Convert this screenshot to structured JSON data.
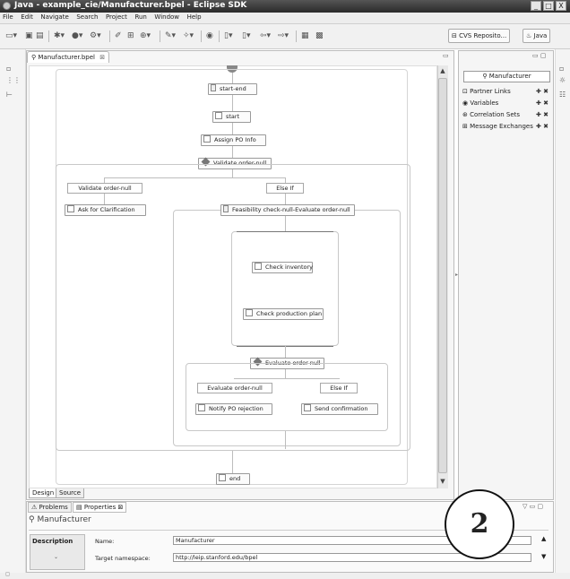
{
  "window": {
    "title": "Java - example_cie/Manufacturer.bpel - Eclipse SDK",
    "controls": [
      "_",
      "□",
      "X"
    ]
  },
  "menu": [
    "File",
    "Edit",
    "Navigate",
    "Search",
    "Project",
    "Run",
    "Window",
    "Help"
  ],
  "toolbar": {
    "cvs_label": "CVS Reposito...",
    "perspective_label": "Java"
  },
  "editor": {
    "tab_label": "Manufacturer.bpel",
    "tab_close": "⊠",
    "bottom_tabs": [
      "Design",
      "Source"
    ]
  },
  "palette": {
    "title": "Manufacturer",
    "sections": [
      "Partner Links",
      "Variables",
      "Correlation Sets",
      "Message Exchanges"
    ],
    "actions": "✚ ✖"
  },
  "diagram": {
    "start_end": "start-end",
    "start": "start",
    "assign": "Assign PO Info",
    "validate_switch": "Validate order-null",
    "case_label": "Validate order-null",
    "else_label": "Else If",
    "ask": "Ask for Clarification",
    "feasibility": "Feasibility check-null-Evaluate order-null",
    "check_inventory": "Check inventory",
    "check_production": "Check production plan",
    "evaluate_switch": "Evaluate order-null",
    "eval_case_label": "Evaluate order-null",
    "eval_else_label": "Else If",
    "notify": "Notify PO rejection",
    "send": "Send confirmation",
    "end": "end"
  },
  "bottom": {
    "tabs": [
      "Problems",
      "Properties"
    ],
    "properties_title": "Manufacturer",
    "description_tab": "Description",
    "name_label": "Name:",
    "name_value": "Manufacturer",
    "namespace_label": "Target namespace:",
    "namespace_value": "http://leip.stanford.edu/bpel"
  },
  "annotation": {
    "number": "2"
  }
}
